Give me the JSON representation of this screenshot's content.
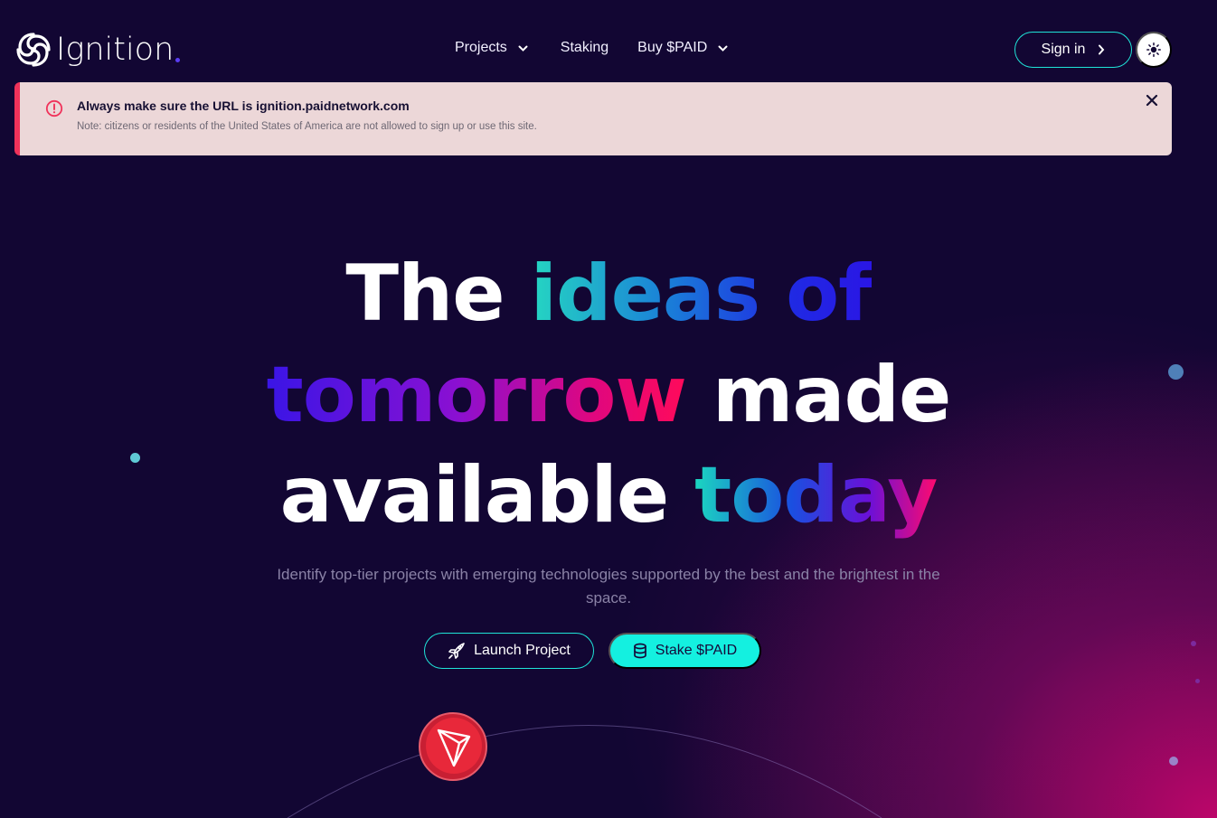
{
  "header": {
    "logo_text": "Ignition",
    "nav": [
      {
        "label": "Projects",
        "has_dropdown": true
      },
      {
        "label": "Staking",
        "has_dropdown": false
      },
      {
        "label": "Buy $PAID",
        "has_dropdown": true
      }
    ],
    "sign_in_label": "Sign in",
    "theme_icon": "sun-icon"
  },
  "alert": {
    "title": "Always make sure the URL is ignition.paidnetwork.com",
    "note": "Note: citizens or residents of the United States of America are not allowed to sign up or use this site.",
    "icon": "alert-circle-icon",
    "close_icon": "close-icon"
  },
  "hero": {
    "line1_plain": "The",
    "line1_accent": "ideas of",
    "line2_accent": "tomorrow",
    "line2_plain": "made",
    "line3_plain": "available",
    "line3_accent": "today",
    "subtitle": "Identify top-tier projects with emerging technologies supported by the best and the brightest in the space.",
    "launch_label": "Launch Project",
    "stake_label": "Stake $PAID"
  },
  "colors": {
    "background": "#120633",
    "accent_teal": "#14f0e0",
    "alert_bg": "#ecd7d8",
    "alert_border": "#f0325a",
    "tron_red": "#e8283a"
  }
}
